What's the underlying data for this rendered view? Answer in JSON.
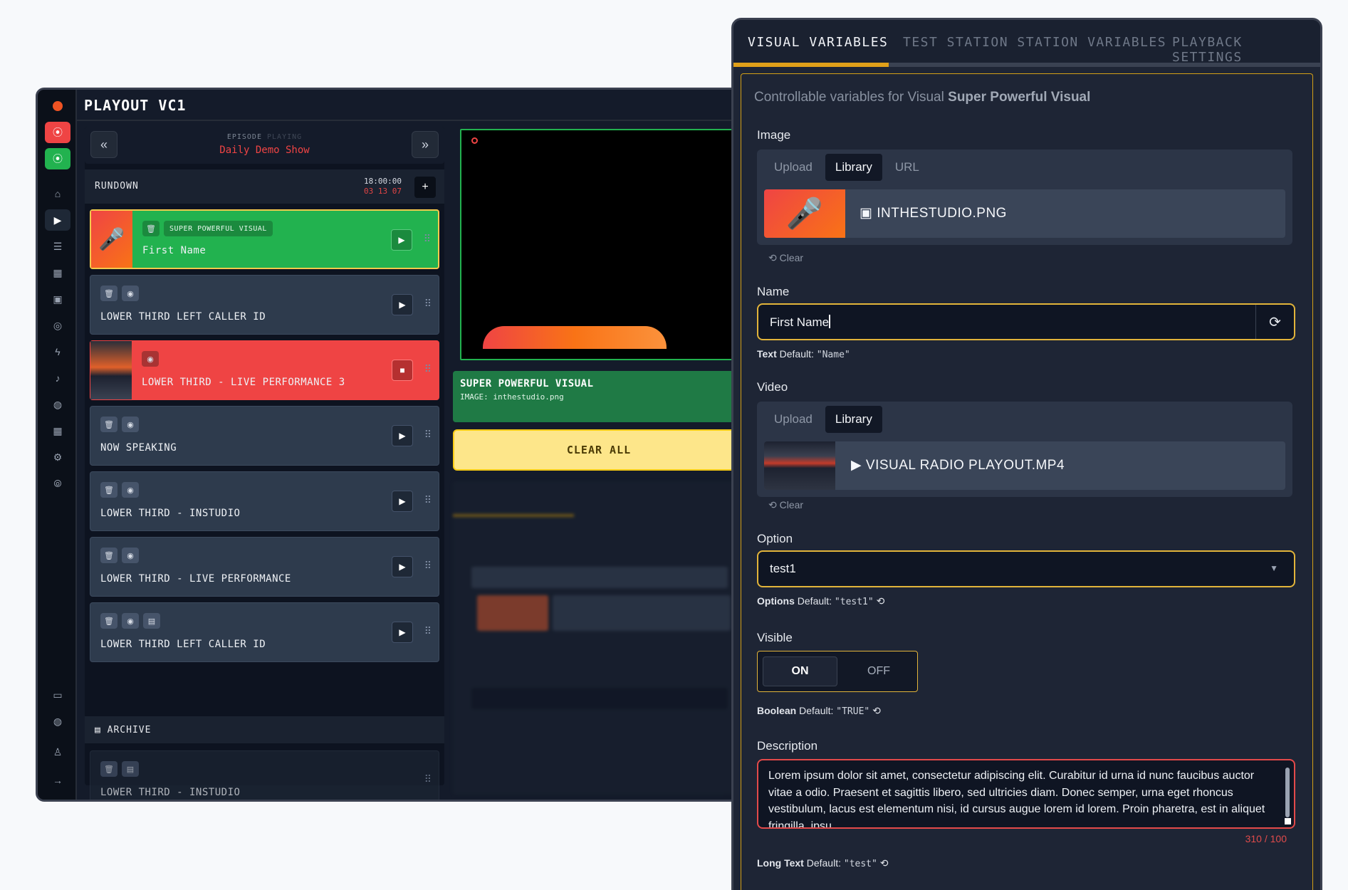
{
  "app": {
    "title": "PLAYOUT VC1"
  },
  "episode": {
    "label": "EPISODE",
    "status": "PLAYING",
    "title": "Daily Demo Show"
  },
  "rundown": {
    "title": "RUNDOWN",
    "time": "18:00:00",
    "countdown": "03 13 07",
    "items": [
      {
        "tag": "SUPER POWERFUL VISUAL",
        "name": "First Name",
        "state": "playing"
      },
      {
        "name": "LOWER THIRD LEFT CALLER ID"
      },
      {
        "name": "LOWER THIRD - LIVE PERFORMANCE 3",
        "state": "live"
      },
      {
        "name": "NOW SPEAKING"
      },
      {
        "name": "LOWER THIRD - INSTUDIO"
      },
      {
        "name": "LOWER THIRD - LIVE PERFORMANCE"
      },
      {
        "name": "LOWER THIRD LEFT CALLER ID"
      }
    ]
  },
  "archive": {
    "title": "ARCHIVE",
    "items": [
      {
        "name": "LOWER THIRD - INSTUDIO"
      }
    ]
  },
  "onair": {
    "title": "SUPER POWERFUL VISUAL",
    "detail": "IMAGE: inthestudio.png"
  },
  "clear_all": "CLEAR ALL",
  "panel": {
    "tabs": [
      "VISUAL VARIABLES",
      "TEST STATION STATION VARIABLES",
      "PLAYBACK SETTINGS"
    ],
    "intro_prefix": "Controllable variables for Visual",
    "intro_visual": "Super Powerful Visual",
    "image": {
      "label": "Image",
      "tabs": [
        "Upload",
        "Library",
        "URL"
      ],
      "file": "INTHESTUDIO.PNG",
      "clear": "Clear"
    },
    "name": {
      "label": "Name",
      "value": "First Name",
      "type": "Text",
      "default_label": "Default:",
      "default": "\"Name\""
    },
    "video": {
      "label": "Video",
      "tabs": [
        "Upload",
        "Library"
      ],
      "file": "VISUAL RADIO PLAYOUT.MP4",
      "clear": "Clear"
    },
    "option": {
      "label": "Option",
      "value": "test1",
      "type": "Options",
      "default_label": "Default:",
      "default": "\"test1\""
    },
    "visible": {
      "label": "Visible",
      "on": "ON",
      "off": "OFF",
      "type": "Boolean",
      "default_label": "Default:",
      "default": "\"TRUE\""
    },
    "description": {
      "label": "Description",
      "value": "Lorem ipsum dolor sit amet, consectetur adipiscing elit. Curabitur id urna id nunc faucibus auctor vitae a odio. Praesent et sagittis libero, sed ultricies diam. Donec semper, urna eget rhoncus vestibulum, lacus est elementum nisi, id cursus augue lorem id lorem. Proin pharetra, est in aliquet fringilla, ipsu",
      "count": "310 / 100",
      "type": "Long Text",
      "default_label": "Default:",
      "default": "\"test\""
    }
  },
  "colors": {
    "accent": "#e2b43a",
    "playing": "#22b24f",
    "live": "#ef4444",
    "error": "#e34a4a"
  }
}
